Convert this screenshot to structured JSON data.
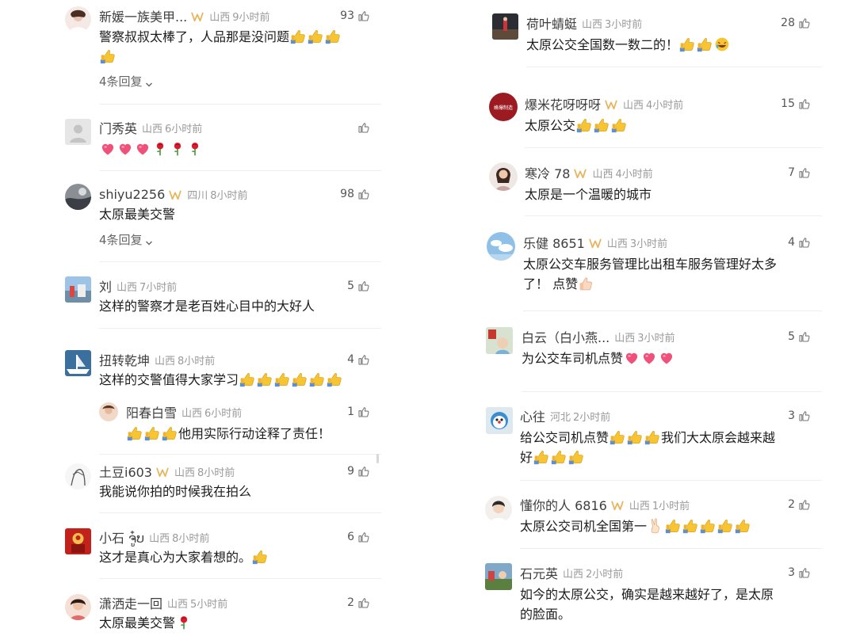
{
  "left": [
    {
      "user": "新媛一族美甲...",
      "vip": true,
      "loc": "山西",
      "time": "9小时前",
      "likes": "93",
      "text": "警察叔叔太棒了，人品那是没问题",
      "replies": "4条回复"
    },
    {
      "user": "门秀英",
      "vip": false,
      "loc": "山西",
      "time": "6小时前",
      "likes": "",
      "text": ""
    },
    {
      "user": "shiyu2256",
      "vip": true,
      "loc": "四川",
      "time": "8小时前",
      "likes": "98",
      "text": "太原最美交警",
      "replies": "4条回复"
    },
    {
      "user": "刘",
      "vip": false,
      "loc": "山西",
      "time": "7小时前",
      "likes": "5",
      "text": "这样的警察才是老百姓心目中的大好人"
    },
    {
      "user": "扭转乾坤",
      "vip": false,
      "loc": "山西",
      "time": "8小时前",
      "likes": "4",
      "text": "这样的交警值得大家学习"
    },
    {
      "user": "阳春白雪",
      "vip": false,
      "loc": "山西",
      "time": "6小时前",
      "likes": "1",
      "text": "他用实际行动诠释了责任！"
    },
    {
      "user": "土豆i603",
      "vip": true,
      "loc": "山西",
      "time": "8小时前",
      "likes": "9",
      "text": "我能说你拍的时候我在拍么"
    },
    {
      "user": "小石 ຈູ໋ບ",
      "vip": false,
      "loc": "山西",
      "time": "8小时前",
      "likes": "6",
      "text": "这才是真心为大家着想的。"
    },
    {
      "user": "潇洒走一回",
      "vip": false,
      "loc": "山西",
      "time": "5小时前",
      "likes": "2",
      "text": "太原最美交警"
    }
  ],
  "right": [
    {
      "user": "荷叶蜻蜓",
      "vip": false,
      "loc": "山西",
      "time": "3小时前",
      "likes": "28",
      "text": "太原公交全国数一数二的！"
    },
    {
      "user": "爆米花呀呀呀",
      "vip": true,
      "loc": "山西",
      "time": "4小时前",
      "likes": "15",
      "text": "太原公交"
    },
    {
      "user": "寒冷 78",
      "vip": true,
      "loc": "山西",
      "time": "4小时前",
      "likes": "7",
      "text": "太原是一个温暖的城市"
    },
    {
      "user": "乐健 8651",
      "vip": true,
      "loc": "山西",
      "time": "3小时前",
      "likes": "4",
      "text_l1": "太原公交车服务管理比出租车服务管理好太多",
      "text_l2": "了！ 点赞"
    },
    {
      "user": "白云（白小燕...",
      "vip": false,
      "loc": "山西",
      "time": "3小时前",
      "likes": "5",
      "text": "为公交车司机点赞"
    },
    {
      "user": "心往",
      "vip": false,
      "loc": "河北",
      "time": "2小时前",
      "likes": "3",
      "text_l1": "给公交司机点赞",
      "text_l1b": "我们大太原会越来越",
      "text_l2": "好"
    },
    {
      "user": "懂你的人 6816",
      "vip": true,
      "loc": "山西",
      "time": "1小时前",
      "likes": "2",
      "text": "太原公交司机全国第一"
    },
    {
      "user": "石元英",
      "vip": false,
      "loc": "山西",
      "time": "2小时前",
      "likes": "3",
      "text_l1": "如今的太原公交，确实是越来越好了，是太原",
      "text_l2": "的脸面。"
    }
  ],
  "avatar_text": {
    "r2": "蜂爆制造"
  },
  "colors": {
    "heart": "#f0517a",
    "thumb_emoji": "#f5b820",
    "vip_badge": "#e7b45c",
    "meta_gray": "#9a9a9a"
  }
}
